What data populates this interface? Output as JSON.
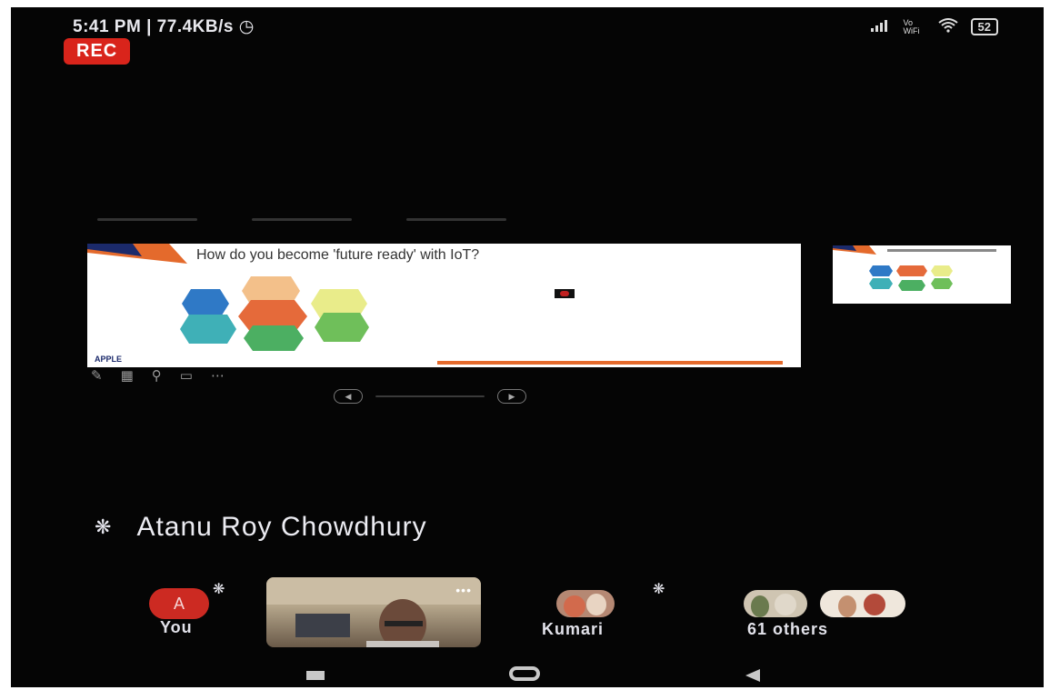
{
  "status_bar": {
    "time_speed": "5:41 PM | 77.4KB/s",
    "alarm_icon": "alarm-icon",
    "signal_icon": "signal-bars-icon",
    "vowifi": "Vo WiFi",
    "wifi_icon": "wifi-icon",
    "battery": "52"
  },
  "recording": {
    "label": "REC"
  },
  "presentation": {
    "slide_title": "How do you become 'future ready' with IoT?",
    "logo_text": "APPLE"
  },
  "presenter": {
    "name": "Atanu Roy Chowdhury",
    "mic_icon": "mic-off-icon"
  },
  "participants": {
    "you": {
      "initial": "A",
      "label": "You"
    },
    "video_more": "•••",
    "kumari": {
      "label": "Kumari"
    },
    "others": {
      "label": "61 others"
    }
  },
  "nav_bar": {
    "recents_icon": "recents-icon",
    "home_icon": "home-icon",
    "back_icon": "back-icon"
  }
}
